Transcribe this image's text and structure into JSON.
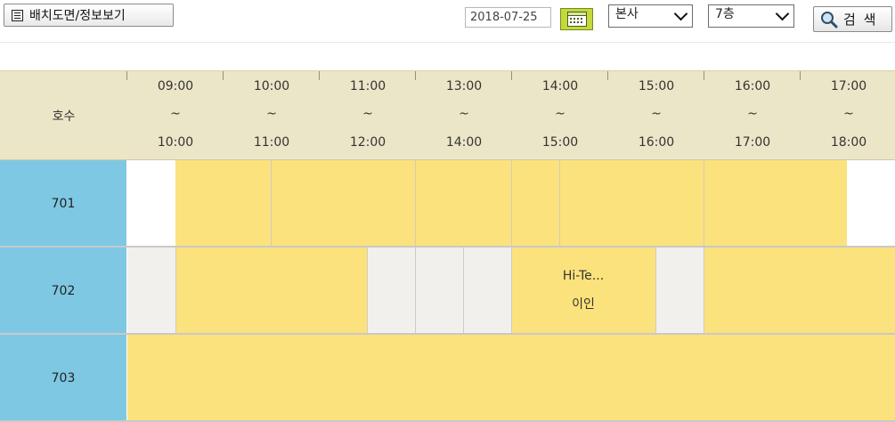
{
  "toolbar": {
    "layout_button_label": "배치도면/정보보기",
    "date_value": "2018-07-25",
    "branch_select": "본사",
    "floor_select": "7층",
    "search_label": "검 색"
  },
  "header": {
    "room_column_label": "호수",
    "time_slots": [
      {
        "start": "09:00",
        "sep": "~",
        "end": "10:00"
      },
      {
        "start": "10:00",
        "sep": "~",
        "end": "11:00"
      },
      {
        "start": "11:00",
        "sep": "~",
        "end": "12:00"
      },
      {
        "start": "13:00",
        "sep": "~",
        "end": "14:00"
      },
      {
        "start": "14:00",
        "sep": "~",
        "end": "15:00"
      },
      {
        "start": "15:00",
        "sep": "~",
        "end": "16:00"
      },
      {
        "start": "16:00",
        "sep": "~",
        "end": "17:00"
      },
      {
        "start": "17:00",
        "sep": "~",
        "end": "18:00"
      }
    ]
  },
  "rooms": [
    {
      "name": "701"
    },
    {
      "name": "702",
      "booking_title": "Hi-Te...",
      "booking_person": "이인"
    },
    {
      "name": "703"
    }
  ],
  "colors": {
    "booked": "#fce27c",
    "available": "#f2f0ec",
    "room_label": "#7ec8e3",
    "header": "#ece6c8"
  }
}
